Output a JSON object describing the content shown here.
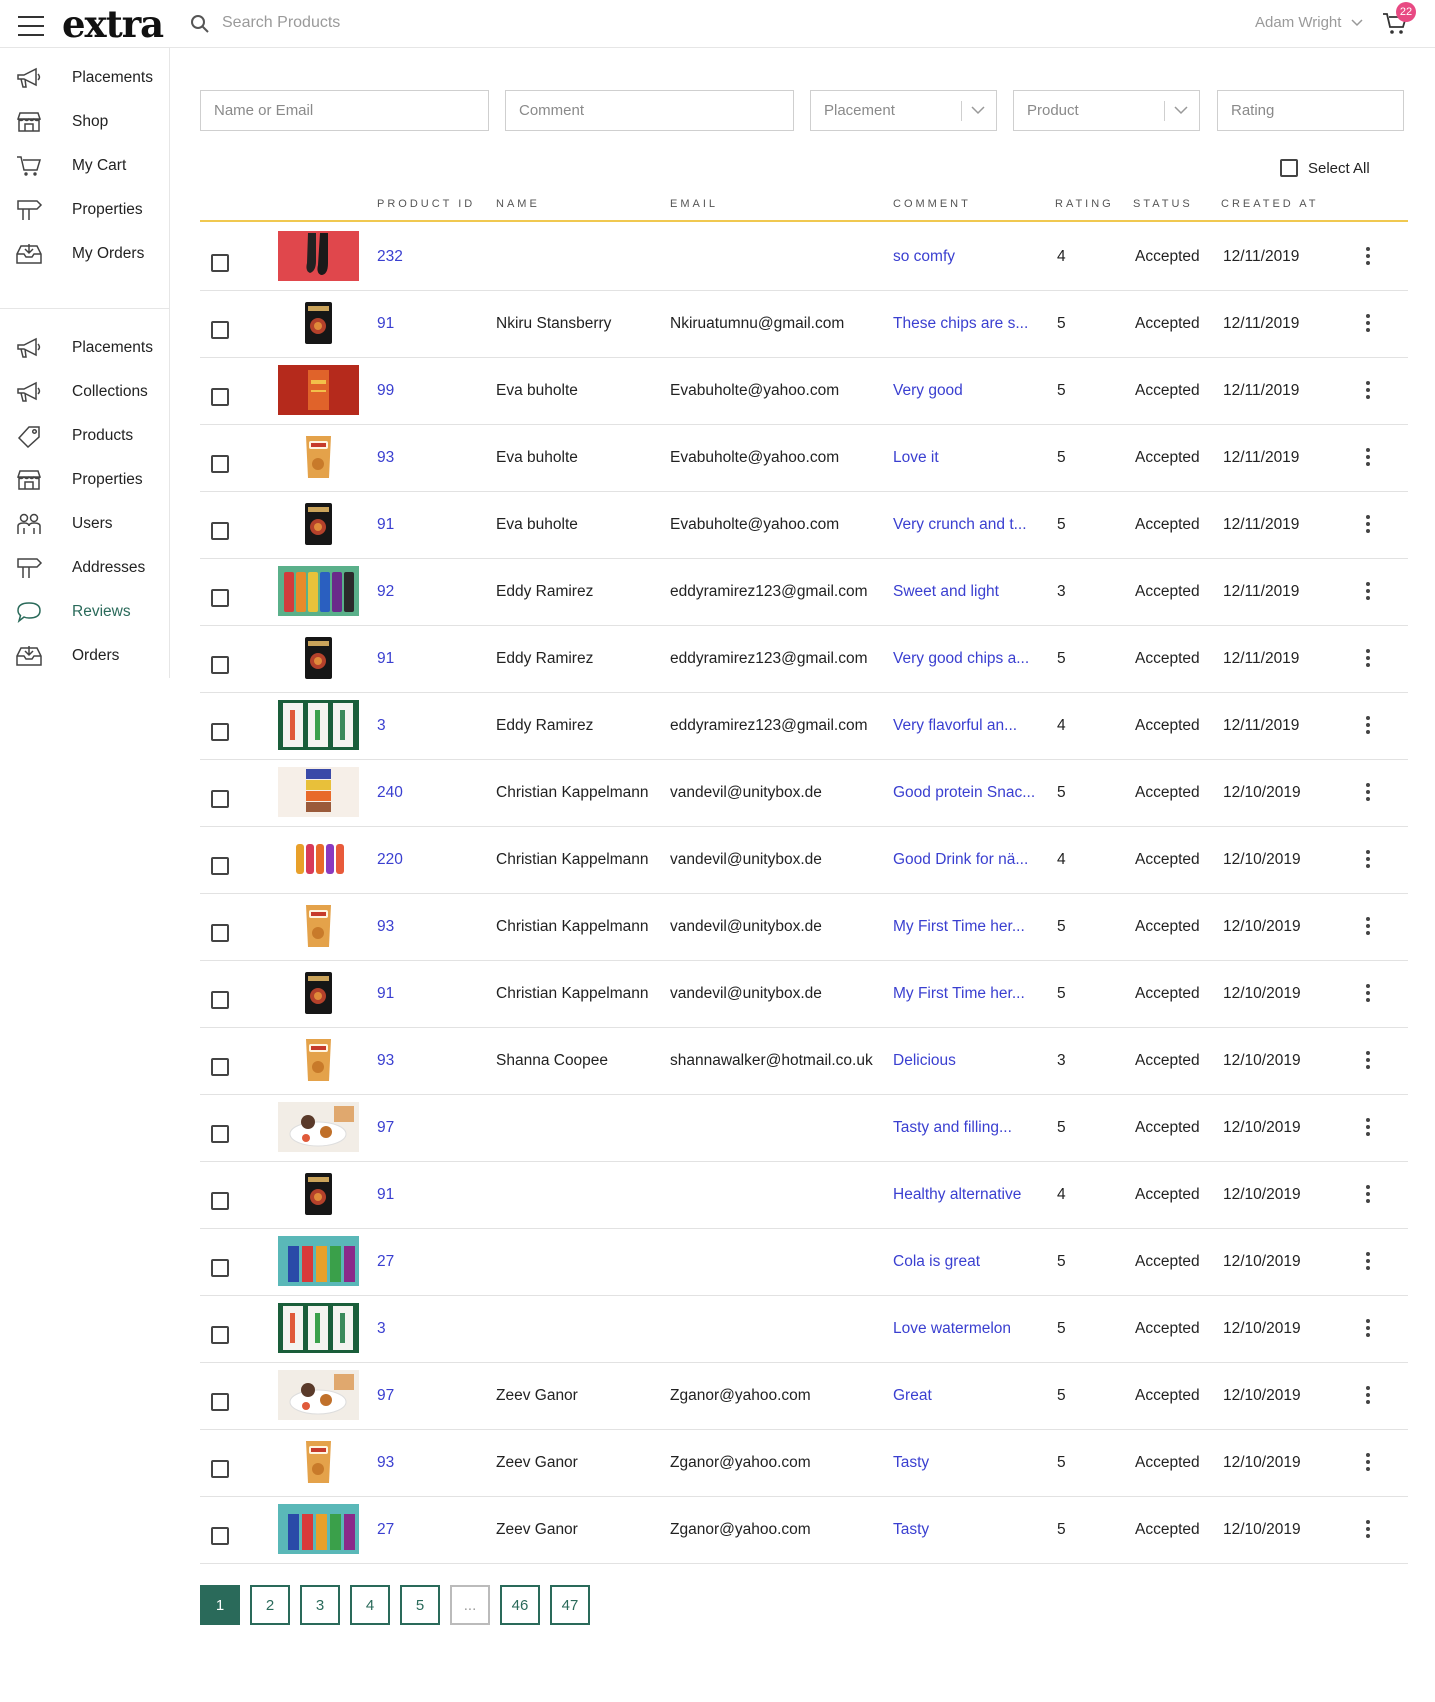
{
  "header": {
    "logo": "extra",
    "search_placeholder": "Search Products",
    "user_name": "Adam Wright",
    "cart_count": "22"
  },
  "sidebar": {
    "items": [
      {
        "label": "Placements",
        "icon": "megaphone-icon"
      },
      {
        "label": "Shop",
        "icon": "storefront-icon"
      },
      {
        "label": "My Cart",
        "icon": "cart-icon"
      },
      {
        "label": "Properties",
        "icon": "signpost-icon"
      },
      {
        "label": "My Orders",
        "icon": "inbox-icon"
      }
    ],
    "admin_items": [
      {
        "label": "Placements",
        "icon": "megaphone-icon"
      },
      {
        "label": "Collections",
        "icon": "megaphone-icon"
      },
      {
        "label": "Products",
        "icon": "tag-icon"
      },
      {
        "label": "Properties",
        "icon": "storefront-icon"
      },
      {
        "label": "Users",
        "icon": "users-icon"
      },
      {
        "label": "Addresses",
        "icon": "signpost-icon"
      },
      {
        "label": "Reviews",
        "icon": "speech-bubble-icon",
        "active": true
      },
      {
        "label": "Orders",
        "icon": "inbox-icon"
      }
    ],
    "active_color": "#2a6a5a"
  },
  "filters": {
    "name_placeholder": "Name or Email",
    "comment_placeholder": "Comment",
    "placement_label": "Placement",
    "product_label": "Product",
    "rating_placeholder": "Rating"
  },
  "select_all_label": "Select All",
  "table": {
    "columns": [
      "Product ID",
      "Name",
      "Email",
      "Comment",
      "Rating",
      "Status",
      "Created At"
    ],
    "rows": [
      {
        "thumb": "socks",
        "pid": "232",
        "name": "",
        "email": "",
        "comment": "so comfy",
        "rating": "4",
        "status": "Accepted",
        "created": "12/11/2019"
      },
      {
        "thumb": "chips-black",
        "pid": "91",
        "name": "Nkiru Stansberry",
        "email": "Nkiruatumnu@gmail.com",
        "comment": "These chips are s...",
        "rating": "5",
        "status": "Accepted",
        "created": "12/11/2019"
      },
      {
        "thumb": "red-box",
        "pid": "99",
        "name": "Eva buholte",
        "email": "Evabuholte@yahoo.com",
        "comment": "Very good",
        "rating": "5",
        "status": "Accepted",
        "created": "12/11/2019"
      },
      {
        "thumb": "chips-orange",
        "pid": "93",
        "name": "Eva buholte",
        "email": "Evabuholte@yahoo.com",
        "comment": "Love it",
        "rating": "5",
        "status": "Accepted",
        "created": "12/11/2019"
      },
      {
        "thumb": "chips-black",
        "pid": "91",
        "name": "Eva buholte",
        "email": "Evabuholte@yahoo.com",
        "comment": "Very crunch and t...",
        "rating": "5",
        "status": "Accepted",
        "created": "12/11/2019"
      },
      {
        "thumb": "bottles-green",
        "pid": "92",
        "name": "Eddy Ramirez",
        "email": "eddyramirez123@gmail.com",
        "comment": "Sweet and light",
        "rating": "3",
        "status": "Accepted",
        "created": "12/11/2019"
      },
      {
        "thumb": "chips-black",
        "pid": "91",
        "name": "Eddy Ramirez",
        "email": "eddyramirez123@gmail.com",
        "comment": "Very good chips a...",
        "rating": "5",
        "status": "Accepted",
        "created": "12/11/2019"
      },
      {
        "thumb": "runa-cans",
        "pid": "3",
        "name": "Eddy Ramirez",
        "email": "eddyramirez123@gmail.com",
        "comment": "Very flavorful an...",
        "rating": "4",
        "status": "Accepted",
        "created": "12/11/2019"
      },
      {
        "thumb": "bars",
        "pid": "240",
        "name": "Christian Kappelmann",
        "email": "vandevil@unitybox.de",
        "comment": "Good protein Snac...",
        "rating": "5",
        "status": "Accepted",
        "created": "12/10/2019"
      },
      {
        "thumb": "drinks",
        "pid": "220",
        "name": "Christian Kappelmann",
        "email": "vandevil@unitybox.de",
        "comment": "Good Drink for nä...",
        "rating": "4",
        "status": "Accepted",
        "created": "12/10/2019"
      },
      {
        "thumb": "chips-orange",
        "pid": "93",
        "name": "Christian Kappelmann",
        "email": "vandevil@unitybox.de",
        "comment": "My First Time her...",
        "rating": "5",
        "status": "Accepted",
        "created": "12/10/2019"
      },
      {
        "thumb": "chips-black",
        "pid": "91",
        "name": "Christian Kappelmann",
        "email": "vandevil@unitybox.de",
        "comment": "My First Time her...",
        "rating": "5",
        "status": "Accepted",
        "created": "12/10/2019"
      },
      {
        "thumb": "chips-orange",
        "pid": "93",
        "name": "Shanna Coopee",
        "email": "shannawalker@hotmail.co.uk",
        "comment": "Delicious",
        "rating": "3",
        "status": "Accepted",
        "created": "12/10/2019"
      },
      {
        "thumb": "food-plate",
        "pid": "97",
        "name": "",
        "email": "",
        "comment": "Tasty and filling...",
        "rating": "5",
        "status": "Accepted",
        "created": "12/10/2019"
      },
      {
        "thumb": "chips-black",
        "pid": "91",
        "name": "",
        "email": "",
        "comment": "Healthy alternative",
        "rating": "4",
        "status": "Accepted",
        "created": "12/10/2019"
      },
      {
        "thumb": "cola-cans",
        "pid": "27",
        "name": "",
        "email": "",
        "comment": "Cola is great",
        "rating": "5",
        "status": "Accepted",
        "created": "12/10/2019"
      },
      {
        "thumb": "runa-cans",
        "pid": "3",
        "name": "",
        "email": "",
        "comment": "Love watermelon",
        "rating": "5",
        "status": "Accepted",
        "created": "12/10/2019"
      },
      {
        "thumb": "food-plate",
        "pid": "97",
        "name": "Zeev Ganor",
        "email": "Zganor@yahoo.com",
        "comment": "Great",
        "rating": "5",
        "status": "Accepted",
        "created": "12/10/2019"
      },
      {
        "thumb": "chips-orange",
        "pid": "93",
        "name": "Zeev Ganor",
        "email": "Zganor@yahoo.com",
        "comment": "Tasty",
        "rating": "5",
        "status": "Accepted",
        "created": "12/10/2019"
      },
      {
        "thumb": "cola-cans",
        "pid": "27",
        "name": "Zeev Ganor",
        "email": "Zganor@yahoo.com",
        "comment": "Tasty",
        "rating": "5",
        "status": "Accepted",
        "created": "12/10/2019"
      }
    ]
  },
  "pagination": {
    "pages": [
      "1",
      "2",
      "3",
      "4",
      "5",
      "...",
      "46",
      "47"
    ],
    "current": "1"
  },
  "colors": {
    "link": "#3a3fd0",
    "accent": "#2a6a5a",
    "header_rule": "#f0c850",
    "badge": "#e84a83"
  }
}
